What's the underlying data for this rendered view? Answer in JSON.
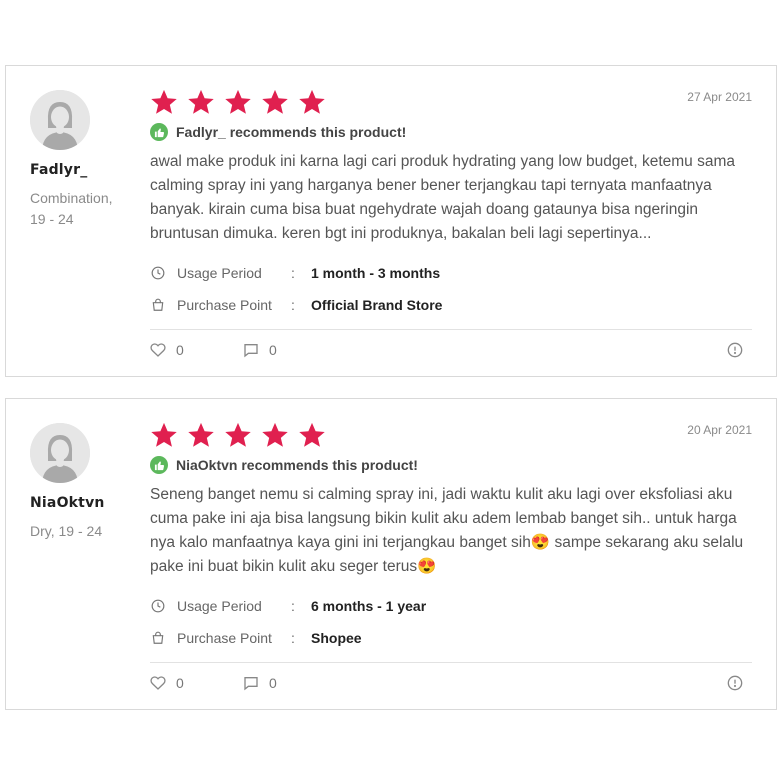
{
  "colors": {
    "star": "#e0204f",
    "recommend_badge": "#5cb85c",
    "border": "#d9d9d9"
  },
  "reviews": [
    {
      "username": "Fadlyr_",
      "skin_info": "Combination, 19 - 24",
      "rating": 5,
      "date": "27 Apr 2021",
      "recommend_text": "Fadlyr_ recommends this product!",
      "text": "awal make produk ini karna lagi cari produk hydrating yang low budget, ketemu sama calming spray ini yang harganya bener bener terjangkau tapi ternyata manfaatnya banyak. kirain cuma bisa buat ngehydrate wajah doang gataunya bisa ngeringin bruntusan dimuka. keren bgt ini produknya, bakalan beli lagi sepertinya...",
      "usage_label": "Usage Period",
      "usage_value": "1 month - 3 months",
      "purchase_label": "Purchase Point",
      "purchase_value": "Official Brand Store",
      "likes": "0",
      "comments": "0"
    },
    {
      "username": "NiaOktvn",
      "skin_info": "Dry, 19 - 24",
      "rating": 5,
      "date": "20 Apr 2021",
      "recommend_text": "NiaOktvn recommends this product!",
      "text": "Seneng banget nemu si calming spray ini, jadi waktu kulit aku lagi over eksfoliasi aku cuma pake ini aja bisa langsung bikin kulit aku adem lembab banget sih.. untuk harga nya kalo manfaatnya kaya gini ini terjangkau banget sih😍 sampe sekarang aku selalu pake ini buat bikin kulit aku seger terus😍",
      "usage_label": "Usage Period",
      "usage_value": "6 months - 1 year",
      "purchase_label": "Purchase Point",
      "purchase_value": "Shopee",
      "likes": "0",
      "comments": "0"
    }
  ],
  "icons": {
    "avatar": "user-avatar-placeholder",
    "star": "star-icon",
    "recommend": "thumbs-up-icon",
    "usage": "clock-icon",
    "purchase": "shopping-bag-icon",
    "like": "heart-icon",
    "comment": "comment-icon",
    "report": "report-icon"
  }
}
